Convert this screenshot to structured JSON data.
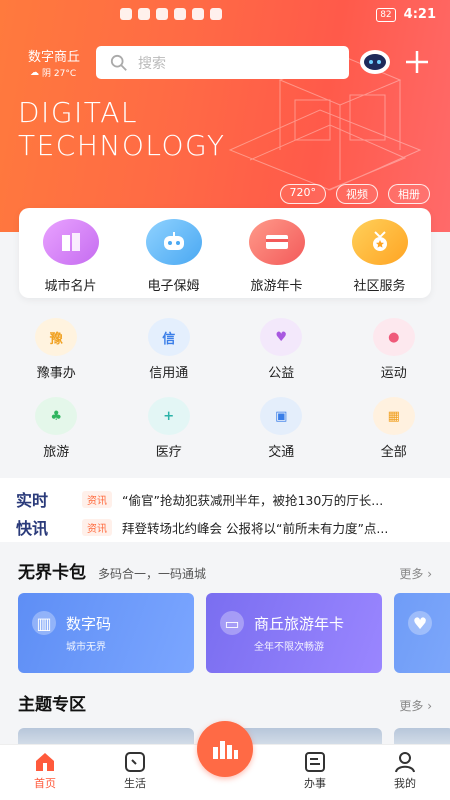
{
  "status_bar": {
    "time": "4:21",
    "battery": "82"
  },
  "header": {
    "city": "数字商丘",
    "weather": "阴 27°C",
    "search_placeholder": "搜索"
  },
  "hero": {
    "title_line1": "DIGITAL",
    "title_line2": "TECHNOLOGY",
    "tags": [
      "720°",
      "视频",
      "相册"
    ]
  },
  "quick_services": [
    {
      "label": "城市名片",
      "icon": "building-icon",
      "color": "#d67cf2"
    },
    {
      "label": "电子保姆",
      "icon": "robot-icon",
      "color": "#5bb8f7"
    },
    {
      "label": "旅游年卡",
      "icon": "card-icon",
      "color": "#ff6e6e"
    },
    {
      "label": "社区服务",
      "icon": "medal-icon",
      "color": "#ffb13a"
    }
  ],
  "services": [
    {
      "label": "豫事办",
      "glyph": "豫",
      "bg": "#fff3df",
      "fg": "#f0a020"
    },
    {
      "label": "信用通",
      "glyph": "信",
      "bg": "#e4effd",
      "fg": "#3a7ee8"
    },
    {
      "label": "公益",
      "glyph": "♥",
      "bg": "#f3e8fb",
      "fg": "#a858e0"
    },
    {
      "label": "运动",
      "glyph": "●",
      "bg": "#fde8ee",
      "fg": "#ef5a7a"
    },
    {
      "label": "旅游",
      "glyph": "♣",
      "bg": "#e4f7ea",
      "fg": "#2fb55f"
    },
    {
      "label": "医疗",
      "glyph": "+",
      "bg": "#e3f6f5",
      "fg": "#2ab3a8"
    },
    {
      "label": "交通",
      "glyph": "▣",
      "bg": "#e4eefb",
      "fg": "#3a7ee8"
    },
    {
      "label": "全部",
      "glyph": "▦",
      "bg": "#fff1df",
      "fg": "#f0a020"
    }
  ],
  "news": [
    {
      "badge": "实时",
      "tag": "资讯",
      "text": "“偷官”抢劫犯获减刑半年，被抢130万的厅长..."
    },
    {
      "badge": "快讯",
      "tag": "资讯",
      "text": "拜登转场北约峰会 公报将以“前所未有力度”点..."
    }
  ],
  "wallet": {
    "title": "无界卡包",
    "subtitle": "多码合一，一码通城",
    "more": "更多",
    "cards": [
      {
        "title": "数字码",
        "sub": "城市无界",
        "gradient": "linear-gradient(110deg,#5e8ef5,#7ba6ff)"
      },
      {
        "title": "商丘旅游年卡",
        "sub": "全年不限次畅游",
        "gradient": "linear-gradient(110deg,#7a6ef0,#9a86ff)"
      },
      {
        "title": "",
        "sub": "",
        "gradient": "linear-gradient(110deg,#6f9cf7,#8fb6ff)"
      }
    ]
  },
  "themes": {
    "title": "主题专区",
    "more": "更多"
  },
  "tabbar": [
    {
      "label": "首页",
      "icon": "home-icon",
      "active": true
    },
    {
      "label": "生活",
      "icon": "life-icon",
      "active": false
    },
    {
      "label": "",
      "icon": "city-center-icon",
      "active": false
    },
    {
      "label": "办事",
      "icon": "affairs-icon",
      "active": false
    },
    {
      "label": "我的",
      "icon": "profile-icon",
      "active": false
    }
  ]
}
